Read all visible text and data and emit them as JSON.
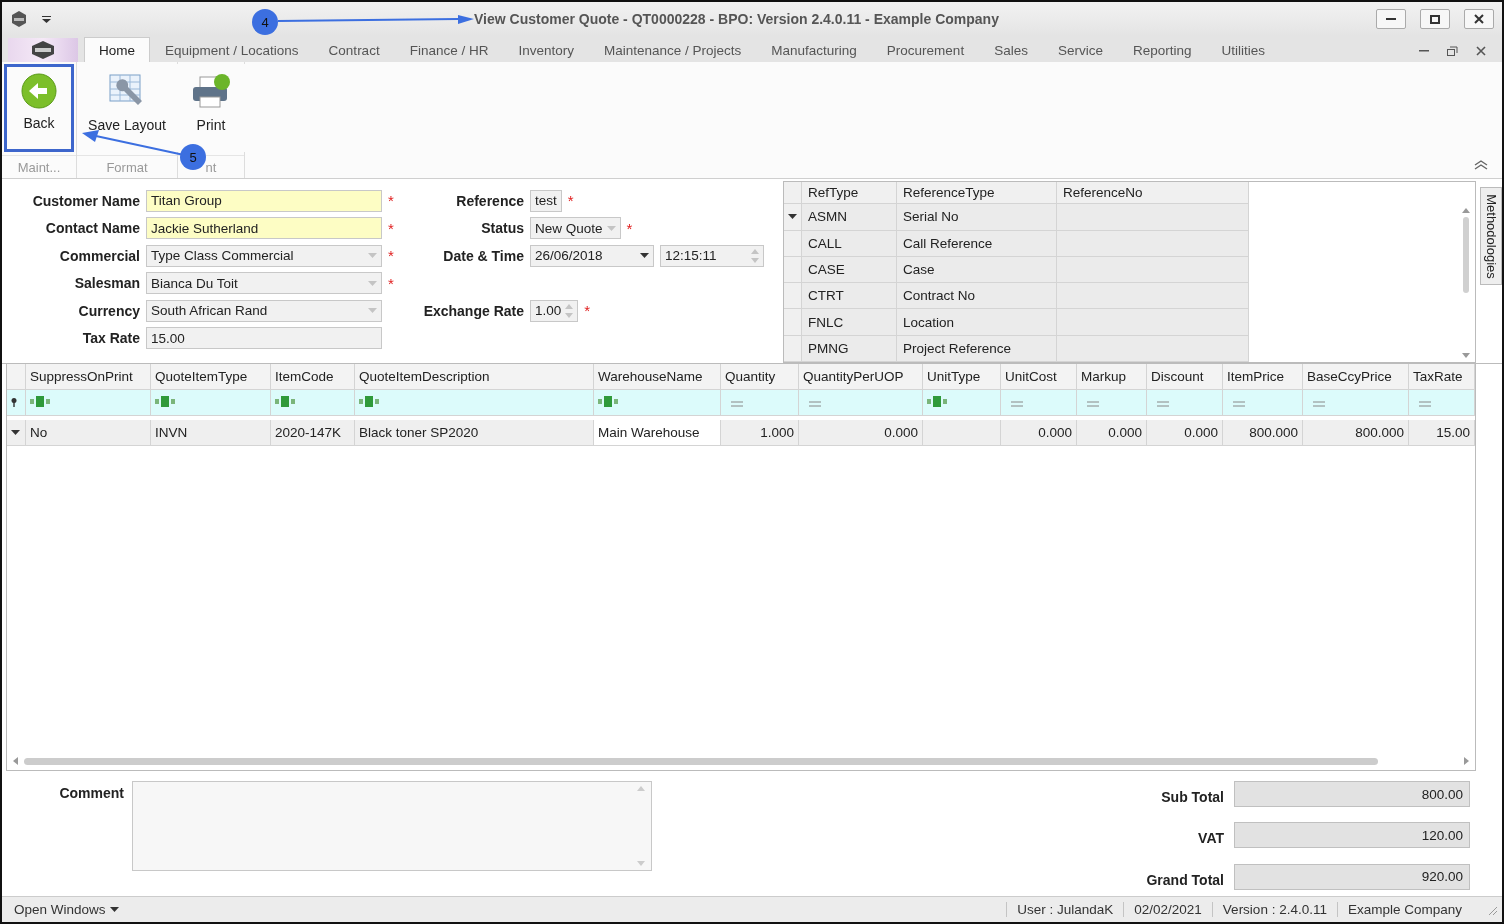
{
  "window": {
    "title": "View Customer Quote - QT0000228 - BPO: Version 2.4.0.11 - Example Company"
  },
  "ribbon_tabs": [
    {
      "label": "Home",
      "selected": true
    },
    {
      "label": "Equipment / Locations",
      "selected": false
    },
    {
      "label": "Contract",
      "selected": false
    },
    {
      "label": "Finance / HR",
      "selected": false
    },
    {
      "label": "Inventory",
      "selected": false
    },
    {
      "label": "Maintenance / Projects",
      "selected": false
    },
    {
      "label": "Manufacturing",
      "selected": false
    },
    {
      "label": "Procurement",
      "selected": false
    },
    {
      "label": "Sales",
      "selected": false
    },
    {
      "label": "Service",
      "selected": false
    },
    {
      "label": "Reporting",
      "selected": false
    },
    {
      "label": "Utilities",
      "selected": false
    }
  ],
  "ribbon_groups": [
    {
      "label": "Maint...",
      "button": {
        "label": "Back",
        "kind": "back",
        "highlighted": true
      }
    },
    {
      "label": "Format",
      "button": {
        "label": "Save Layout",
        "kind": "layout",
        "highlighted": false
      }
    },
    {
      "label": "nt",
      "button": {
        "label": "Print",
        "kind": "print",
        "highlighted": false
      }
    }
  ],
  "callouts": [
    {
      "number": "4"
    },
    {
      "number": "5"
    }
  ],
  "form": {
    "required_mark": "*",
    "left": [
      {
        "label": "Customer Name",
        "kind": "text",
        "value": "Titan Group",
        "highlighted": true,
        "required": true
      },
      {
        "label": "Contact Name",
        "kind": "text",
        "value": "Jackie Sutherland",
        "highlighted": true,
        "required": true
      },
      {
        "label": "Commercial",
        "kind": "combo",
        "value": "Type Class Commercial",
        "highlighted": false,
        "required": true
      },
      {
        "label": "Salesman",
        "kind": "combo",
        "value": "Bianca Du Toit",
        "highlighted": false,
        "required": true
      },
      {
        "label": "Currency",
        "kind": "combo",
        "value": "South African Rand",
        "highlighted": false,
        "required": false
      },
      {
        "label": "Tax Rate",
        "kind": "text",
        "value": "15.00",
        "highlighted": false,
        "required": false
      }
    ],
    "right": [
      {
        "label": "Reference",
        "kind": "text",
        "value": "test",
        "required": true
      },
      {
        "label": "Status",
        "kind": "combo",
        "value": "New Quote",
        "required": true
      },
      {
        "label": "Date & Time",
        "kind": "datetime",
        "value": "26/06/2018",
        "time": "12:15:11",
        "required": false
      },
      {
        "label": "Exchange Rate",
        "kind": "spin",
        "value": "1.00",
        "required": true
      }
    ]
  },
  "references": {
    "columns": [
      "RefType",
      "ReferenceType",
      "ReferenceNo"
    ],
    "rows": [
      {
        "ref_type": "ASMN",
        "reference_type": "Serial No",
        "selected": true
      },
      {
        "ref_type": "CALL",
        "reference_type": "Call Reference",
        "selected": false
      },
      {
        "ref_type": "CASE",
        "reference_type": "Case",
        "selected": false
      },
      {
        "ref_type": "CTRT",
        "reference_type": "Contract No",
        "selected": false
      },
      {
        "ref_type": "FNLC",
        "reference_type": "Location",
        "selected": false
      },
      {
        "ref_type": "PMNG",
        "reference_type": "Project Reference",
        "selected": false
      }
    ]
  },
  "side_tab": "Methodologies",
  "items": {
    "columns": [
      {
        "label": "SuppressOnPrint",
        "kind": "text"
      },
      {
        "label": "QuoteItemType",
        "kind": "text"
      },
      {
        "label": "ItemCode",
        "kind": "text"
      },
      {
        "label": "QuoteItemDescription",
        "kind": "text"
      },
      {
        "label": "WarehouseName",
        "kind": "text"
      },
      {
        "label": "Quantity",
        "kind": "number"
      },
      {
        "label": "QuantityPerUOP",
        "kind": "number"
      },
      {
        "label": "UnitType",
        "kind": "text"
      },
      {
        "label": "UnitCost",
        "kind": "number"
      },
      {
        "label": "Markup",
        "kind": "number"
      },
      {
        "label": "Discount",
        "kind": "number"
      },
      {
        "label": "ItemPrice",
        "kind": "number"
      },
      {
        "label": "BaseCcyPrice",
        "kind": "number"
      },
      {
        "label": "TaxRate",
        "kind": "number"
      }
    ],
    "rows": [
      {
        "selected": true,
        "cells": [
          "No",
          "INVN",
          "2020-147K",
          "Black toner SP2020",
          "Main Warehouse",
          "1.000",
          "0.000",
          null,
          "0.000",
          "0.000",
          "0.000",
          "800.000",
          "800.000",
          "15.00"
        ]
      }
    ]
  },
  "comment": {
    "label": "Comment"
  },
  "totals": [
    {
      "label": "Sub Total",
      "value": "800.00"
    },
    {
      "label": "VAT",
      "value": "120.00"
    },
    {
      "label": "Grand Total",
      "value": "920.00"
    }
  ],
  "status_bar": {
    "menu": "Open Windows",
    "items": [
      "User : JulandaK",
      "02/02/2021",
      "Version : 2.4.0.11",
      "Example Company"
    ]
  }
}
